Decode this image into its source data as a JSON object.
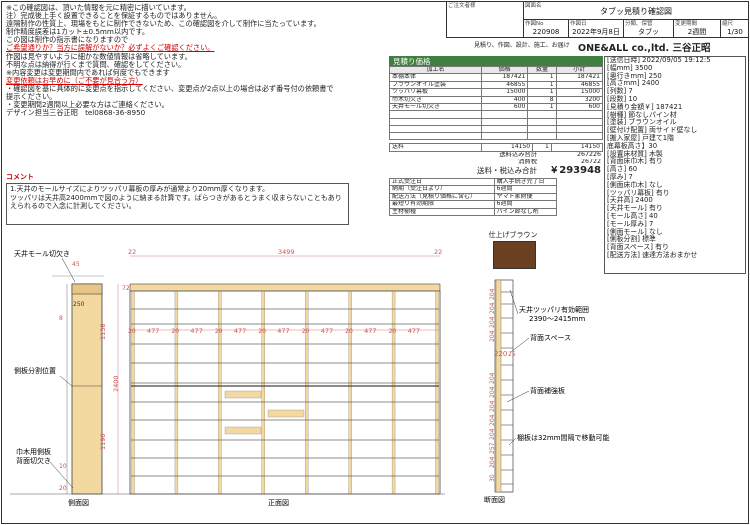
{
  "title_block": {
    "customer_label": "ご注文者様",
    "drawing_title_label": "図面名",
    "drawing_title": "タブッ見積り確認図",
    "number_label": "作図No",
    "number": "220908",
    "date_label": "作図日",
    "date": "2022年9月8日",
    "category_label": "分類、保管",
    "category": "タブッ",
    "revision_label": "変更期間",
    "revision": "2週間",
    "scale_label": "縮尺",
    "scale": "1/30",
    "sub_line": "見積り、作図、設計、施工、お届け",
    "company": "ONE&ALL co.,ltd. 三谷正昭"
  },
  "notes": [
    {
      "text": "※この確認図は、頂いた情報を元に精密に描いています。",
      "style": "normal"
    },
    {
      "text": "注）完成後上手く設置できることを保証するものではありません。",
      "style": "normal"
    },
    {
      "text": "遠隔制作の性質上、現場をもとに制作できないため、この確認図を介して制作に当たっています。",
      "style": "normal"
    },
    {
      "text": "制作精度誤差は1カット±0.5mm以内です。",
      "style": "normal"
    },
    {
      "text": "この図は制作の指示書になりますので",
      "style": "normal"
    },
    {
      "text": "ご希望通りか？当方に誤解がないか？必ずよくご確認ください。",
      "style": "red"
    },
    {
      "text": "作図は見やすいように細かな数値情報は省略しています。",
      "style": "normal"
    },
    {
      "text": "不明な点は納得が行くまで質問、確認をしてください。",
      "style": "normal"
    },
    {
      "text": "※内容変更は変更期間内であれば何度でもできます",
      "style": "normal"
    },
    {
      "text": "変更依頼はお早めに（ご不要が見合う方）",
      "style": "red"
    },
    {
      "text": "・確認図を基に具体的に変更点を指示してください、変更点が2点以上の場合は必ず番号付の依頼書で提示ください。",
      "style": "normal"
    },
    {
      "text": "・変更期間2週間以上必要な方はご連絡ください。",
      "style": "normal"
    },
    {
      "text": "デザイン担当三谷正昭　tel0868-36-8950",
      "style": "normal"
    }
  ],
  "comment": {
    "title": "コメント",
    "lines": [
      "1.天井のモールサイズによりツッパリ幕板の厚みが通常より20mm厚くなります。",
      "ツッパリは天井高2400mmで図のように納まる計算です。ばらつきがあるとうまく収まらないこともありえられるので入念に計測してください。"
    ]
  },
  "estimate": {
    "title": "見積り価格",
    "headers": [
      "加工名",
      "価格",
      "数量",
      "小計"
    ],
    "rows": [
      [
        "本棚本体",
        "187421",
        "1",
        "187421"
      ],
      [
        "ブラウンオイル塗装",
        "46855",
        "1",
        "46855"
      ],
      [
        "ツッパリ幕板",
        "15000",
        "1",
        "15000"
      ],
      [
        "巾木切欠き",
        "400",
        "8",
        "3200"
      ],
      [
        "天井モール切欠き",
        "600",
        "1",
        "600"
      ],
      [
        "",
        "",
        "",
        ""
      ],
      [
        "",
        "",
        "",
        ""
      ],
      [
        "",
        "",
        "",
        ""
      ],
      [
        "",
        "",
        "",
        ""
      ]
    ],
    "shipping_label": "送料",
    "shipping_price": "14150",
    "shipping_qty": "1",
    "shipping_sub": "14150",
    "subtotal_label": "送料込み合計",
    "subtotal": "267226",
    "tax_label": "消費税",
    "tax": "26722",
    "total_label": "送料・税込み合計",
    "total": "￥293948",
    "info": [
      [
        "正式受注日",
        "購入手続き完了日"
      ],
      [
        "納期（受注日より）",
        "6週間"
      ],
      [
        "配送方法（見積り価格に含む）",
        "ヤマト家財便"
      ],
      [
        "最短り有効期限",
        "6週間"
      ],
      [
        "主材樹種",
        "パイン節なし剤"
      ]
    ]
  },
  "spec": [
    "[送信日時] 2022/09/05 19:12:5",
    "[幅mm] 3500",
    "[奥行きmm] 250",
    "[高さmm] 2400",
    "[列数] 7",
    "[段数] 10",
    "[見積り金額￥] 187421",
    "[樹種] 節なしパイン材",
    "[塗装] ブラウンオイル",
    "[壁付け配置] 両サイド壁なし",
    "[搬入家屋] 戸建て1階",
    "底幕板高さ】30",
    "[設置床材質] 木製",
    "[背面床巾木] 有り",
    "[高さ] 60",
    "[厚み] 7",
    "[側面床巾木] なし",
    "[ツッパリ幕板] 有り",
    "[天井高] 2400",
    "[天井モール] 有り",
    "[モール高さ] 40",
    "[モール厚み] 7",
    "[側面モール] なし",
    "[側板分割] 標準",
    "[背面スペース] 有り",
    "[配送方法] 速達方法おまかせ"
  ],
  "finish": {
    "label": "仕上げブラウン",
    "color": "#6b3f22"
  },
  "drawings": {
    "side_title": "側面図",
    "front_title": "正面図",
    "section_title": "断面図",
    "ceiling_notch": "天井モール切欠き",
    "side_split": "側板分割位置",
    "baseboard_notch": "巾木用側板\n背面切欠き",
    "tension_range": "天井ツッパリ有効範囲\n2390～2415mm",
    "back_space": "背面スペース",
    "back_reinforce": "背面補強板",
    "shelf_pitch": "棚板は32mm間隔で移動可能",
    "width_total": "3499",
    "side_margin": "22",
    "col_width": "477",
    "col_gap": "20",
    "height_total": "2400",
    "upper_height": "1138",
    "lower_height": "1190",
    "top_dim": "72",
    "side_top": "45",
    "side_250": "250",
    "side_20": "20",
    "side_8": "8",
    "side_10": "10",
    "section_dims": [
      "204",
      "204",
      "204",
      "204",
      "220",
      "25",
      "204",
      "204",
      "204",
      "204",
      "204",
      "257",
      "204",
      "30"
    ]
  }
}
